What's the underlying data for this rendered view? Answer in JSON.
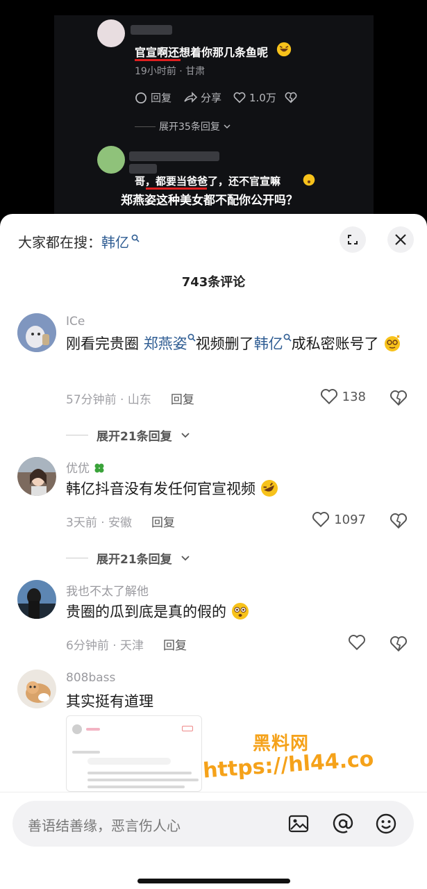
{
  "video": {
    "comment1_text": "官宣啊还想着你那几条鱼呢",
    "comment1_meta": "19小时前 · 甘肃",
    "reply_label": "回复",
    "share_label": "分享",
    "like_count": "1.0万",
    "expand_label": "展开35条回复",
    "comment2_text": "哥，都要当爸爸了，还不官宣嘛",
    "caption": "郑燕姿这种美女都不配你公开吗？"
  },
  "sheet": {
    "search_prefix": "大家都在搜：",
    "search_term": "韩亿",
    "comment_count": "743条评论"
  },
  "comments": [
    {
      "name": "ICe",
      "text_a": "刚看完贵圈 ",
      "link1": "郑燕姿",
      "text_b": "视频删了",
      "link2": "韩亿",
      "text_c": "成私密账号了",
      "meta": "57分钟前 · 山东",
      "reply": "回复",
      "likes": "138",
      "expand": "展开21条回复"
    },
    {
      "name": "优优",
      "text": "韩亿抖音没有发任何官宣视频",
      "meta": "3天前 · 安徽",
      "reply": "回复",
      "likes": "1097",
      "expand": "展开21条回复"
    },
    {
      "name": "我也不太了解他",
      "text": "贵圈的瓜到底是真的假的",
      "meta": "6分钟前 · 天津",
      "reply": "回复"
    },
    {
      "name": "808bass",
      "text": "其实挺有道理"
    }
  ],
  "watermark": {
    "title": "黑料网",
    "url": "https://hl44.co"
  },
  "input": {
    "placeholder": "善语结善缘，恶言伤人心"
  },
  "colors": {
    "link": "#2f5d93",
    "watermark": "#f5a21a",
    "underline": "#e02020"
  },
  "icons": [
    "search-icon",
    "expand-icon",
    "close-icon",
    "heart-icon",
    "dislike-heart-icon",
    "chevron-down-icon",
    "image-icon",
    "at-icon",
    "emoji-icon"
  ]
}
